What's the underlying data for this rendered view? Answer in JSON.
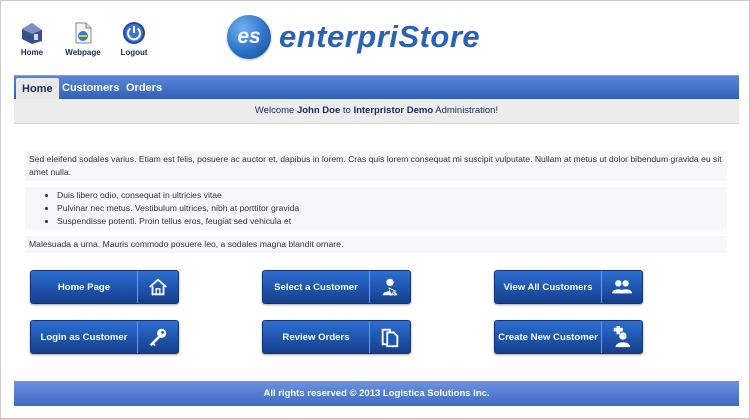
{
  "header": {
    "links": [
      {
        "label": "Home",
        "icon": "home-house-icon"
      },
      {
        "label": "Webpage",
        "icon": "webpage-icon"
      },
      {
        "label": "Logout",
        "icon": "power-icon"
      }
    ],
    "logo": {
      "badge": "es",
      "text": "enterpriStore"
    }
  },
  "nav": {
    "tabs": [
      {
        "label": "Home",
        "active": true
      },
      {
        "label": "Customers",
        "active": false
      },
      {
        "label": "Orders",
        "active": false
      }
    ]
  },
  "welcome": {
    "prefix": "Welcome ",
    "user": "John Doe",
    "middle": " to ",
    "store": "Interpristor Demo",
    "suffix": " Administration!"
  },
  "content": {
    "paragraph1": "Sed eleifend sodales varius. Etiam est felis, posuere ac auctor et, dapibus in lorem. Cras quis lorem consequat mi suscipit vulputate. Nullam at metus ut dolor bibendum gravida eu sit amet nulla.",
    "bullets": [
      "Duis libero odio, consequat in ultricies vitae",
      "Pulvinar nec metus. Vestibulum ultrices, nibh at porttitor gravida",
      "Suspendisse potenti. Proin tellus eros, feugiat sed vehicula et"
    ],
    "paragraph2": "Malesuada a urna. Mauris commodo posuere leo, a sodales magna blandit ornare."
  },
  "buttons": [
    {
      "label": "Home Page",
      "icon": "home-icon"
    },
    {
      "label": "Select a Customer",
      "icon": "select-customer-icon"
    },
    {
      "label": "View All Customers",
      "icon": "users-icon"
    },
    {
      "label": "Login as Customer",
      "icon": "key-icon"
    },
    {
      "label": "Review Orders",
      "icon": "documents-icon"
    },
    {
      "label": "Create New Customer",
      "icon": "add-user-icon"
    }
  ],
  "footer": {
    "text": "All rights reserved © 2013 Logistica Solutions Inc."
  },
  "colors": {
    "brand_blue": "#2b62b6",
    "nav_blue": "#3f6ac4",
    "button_blue": "#1f56b0"
  }
}
